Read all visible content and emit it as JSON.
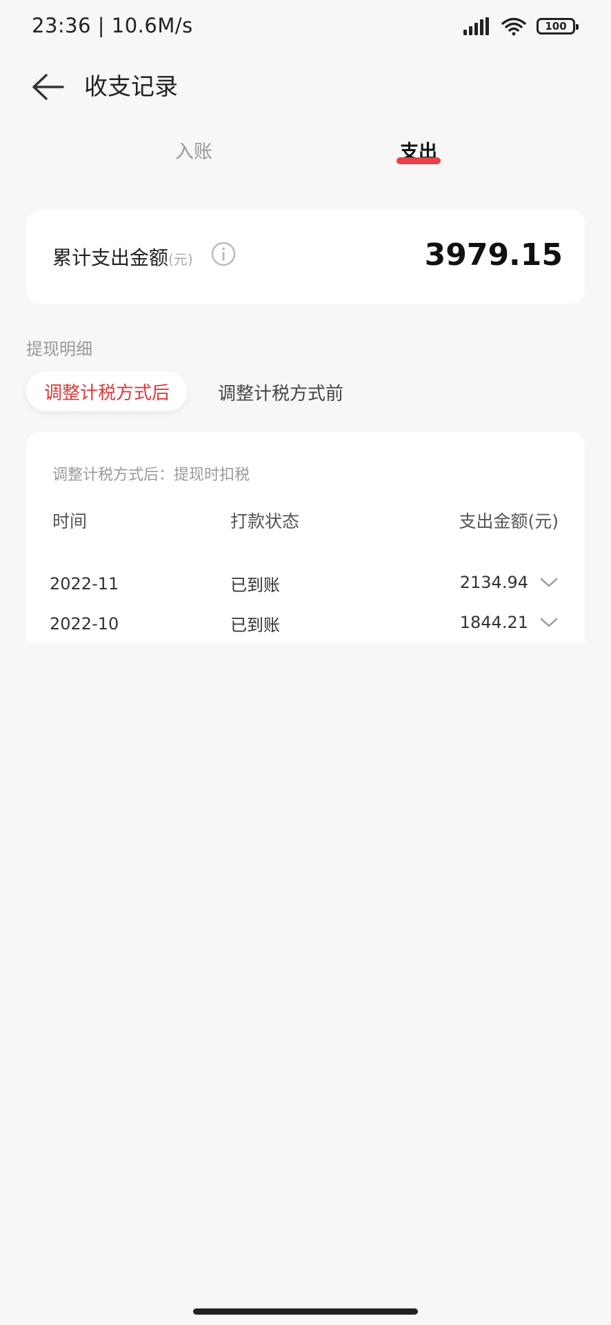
{
  "status_bar": {
    "time": "23:36 | 10.6M/s",
    "battery": "100"
  },
  "header": {
    "title": "收支记录"
  },
  "tabs": [
    {
      "label": "入账",
      "active": false
    },
    {
      "label": "支出",
      "active": true
    }
  ],
  "summary": {
    "label": "累计支出金额",
    "unit": "(元)",
    "value": "3979.15"
  },
  "section": {
    "title": "提现明细"
  },
  "subtabs": [
    {
      "label": "调整计税方式后",
      "active": true
    },
    {
      "label": "调整计税方式前",
      "active": false
    }
  ],
  "detail": {
    "note": "调整计税方式后：提现时扣税",
    "columns": {
      "time": "时间",
      "status": "打款状态",
      "amount": "支出金额(元)"
    },
    "rows": [
      {
        "date": "2022-11",
        "status": "已到账",
        "amount": "2134.94"
      },
      {
        "date": "2022-10",
        "status": "已到账",
        "amount": "1844.21"
      }
    ]
  },
  "colors": {
    "accent": "#e8404b",
    "active_subtab_text": "#d93a3a",
    "background": "#f7f7f7"
  }
}
